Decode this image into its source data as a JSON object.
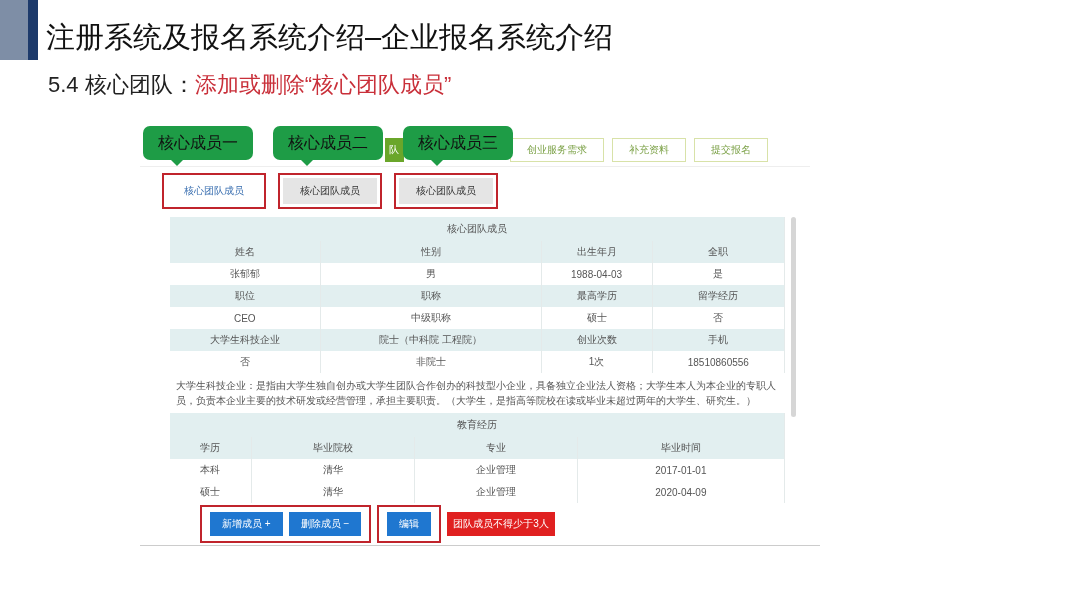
{
  "slide": {
    "title": "注册系统及报名系统介绍–企业报名系统介绍",
    "subtitle_lead": "5.4 核心团队：",
    "subtitle_highlight": "添加或删除“核心团队成员”"
  },
  "screenshot": {
    "steps": [
      {
        "label": "队",
        "selected": true
      },
      {
        "label": "创业服务需求",
        "selected": false
      },
      {
        "label": "补充资料",
        "selected": false
      },
      {
        "label": "提交报名",
        "selected": false
      }
    ],
    "callouts": [
      "核心成员一",
      "核心成员二",
      "核心成员三"
    ],
    "tabs": [
      {
        "label": "核心团队成员",
        "selected": true
      },
      {
        "label": "核心团队成员",
        "selected": false
      },
      {
        "label": "核心团队成员",
        "selected": false
      }
    ],
    "member_table": {
      "title": "核心团队成员",
      "rows": [
        {
          "kind": "header",
          "cells": [
            "姓名",
            "性别",
            "出生年月",
            "全职"
          ]
        },
        {
          "kind": "value",
          "cells": [
            "张郁郁",
            "男",
            "1988-04-03",
            "是"
          ]
        },
        {
          "kind": "header",
          "cells": [
            "职位",
            "职称",
            "最高学历",
            "留学经历"
          ]
        },
        {
          "kind": "value",
          "cells": [
            "CEO",
            "中级职称",
            "硕士",
            "否"
          ]
        },
        {
          "kind": "header",
          "cells": [
            "大学生科技企业",
            "院士（中科院 工程院）",
            "创业次数",
            "手机"
          ]
        },
        {
          "kind": "value",
          "cells": [
            "否",
            "非院士",
            "1次",
            "18510860556"
          ]
        }
      ]
    },
    "note": "大学生科技企业：是指由大学生独自创办或大学生团队合作创办的科技型小企业，具备独立企业法人资格；大学生本人为本企业的专职人员，负责本企业主要的技术研发或经营管理，承担主要职责。（大学生，是指高等院校在读或毕业未超过两年的大学生、研究生。）",
    "education_table": {
      "title": "教育经历",
      "rows": [
        {
          "kind": "header",
          "cells": [
            "学历",
            "毕业院校",
            "专业",
            "毕业时间"
          ]
        },
        {
          "kind": "value",
          "cells": [
            "本科",
            "清华",
            "企业管理",
            "2017-01-01"
          ]
        },
        {
          "kind": "value",
          "cells": [
            "硕士",
            "清华",
            "企业管理",
            "2020-04-09"
          ]
        }
      ]
    },
    "button_groups": [
      [
        "新增成员 +",
        "删除成员 −"
      ],
      [
        "编辑"
      ]
    ],
    "warning": "团队成员不得少于3人"
  }
}
